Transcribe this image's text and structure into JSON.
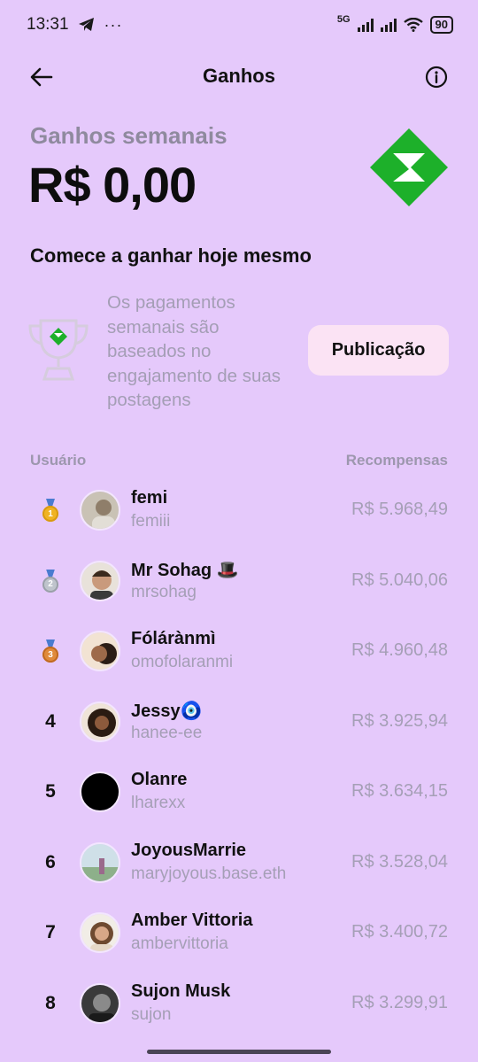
{
  "status_bar": {
    "time": "13:31",
    "network": "5G",
    "battery": "90"
  },
  "header": {
    "title": "Ganhos"
  },
  "earnings": {
    "label": "Ganhos semanais",
    "amount": "R$ 0,00"
  },
  "start": {
    "heading": "Comece a ganhar hoje mesmo"
  },
  "info": {
    "text": "Os pagamentos semanais são baseados no engajamento de suas postagens",
    "button_label": "Publicação"
  },
  "columns": {
    "user": "Usuário",
    "rewards": "Recompensas"
  },
  "colors": {
    "background": "#E5C9FB",
    "brand_green": "#1DB02A",
    "button_bg": "#FBE3F4",
    "muted_text": "#A59FB6"
  },
  "leaderboard": [
    {
      "rank": "1",
      "medal": "gold",
      "name": "femi",
      "handle": "femiii",
      "reward": "R$ 5.968,49"
    },
    {
      "rank": "2",
      "medal": "silver",
      "name": "Mr Sohag 🎩",
      "handle": "mrsohag",
      "reward": "R$ 5.040,06"
    },
    {
      "rank": "3",
      "medal": "bronze",
      "name": "Fólárànmì",
      "handle": "omofolaranmi",
      "reward": "R$ 4.960,48"
    },
    {
      "rank": "4",
      "medal": "",
      "name": "Jessy🧿",
      "handle": "hanee-ee",
      "reward": "R$ 3.925,94"
    },
    {
      "rank": "5",
      "medal": "",
      "name": "Olanre",
      "handle": "lharexx",
      "reward": "R$ 3.634,15"
    },
    {
      "rank": "6",
      "medal": "",
      "name": "JoyousMarrie",
      "handle": "maryjoyous.base.eth",
      "reward": "R$ 3.528,04"
    },
    {
      "rank": "7",
      "medal": "",
      "name": "Amber Vittoria",
      "handle": "ambervittoria",
      "reward": "R$ 3.400,72"
    },
    {
      "rank": "8",
      "medal": "",
      "name": "Sujon Musk",
      "handle": "sujon",
      "reward": "R$ 3.299,91"
    }
  ]
}
